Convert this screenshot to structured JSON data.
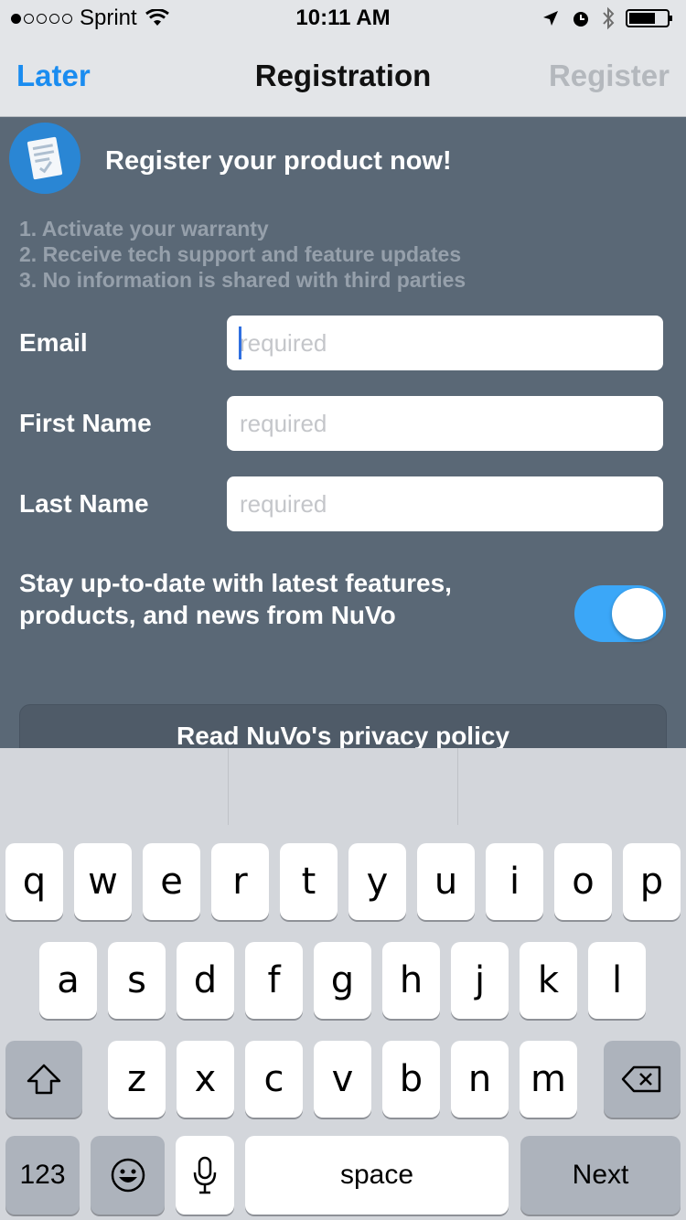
{
  "status_bar": {
    "carrier": "Sprint",
    "time": "10:11 AM"
  },
  "nav": {
    "left": "Later",
    "title": "Registration",
    "right": "Register"
  },
  "header": {
    "title": "Register your product now!"
  },
  "steps": [
    "1. Activate your warranty",
    "2. Receive tech support and feature updates",
    "3. No information is shared with third parties"
  ],
  "form": {
    "email": {
      "label": "Email",
      "placeholder": "required",
      "value": ""
    },
    "first_name": {
      "label": "First Name",
      "placeholder": "required",
      "value": ""
    },
    "last_name": {
      "label": "Last Name",
      "placeholder": "required",
      "value": ""
    }
  },
  "optin": {
    "label": "Stay up-to-date with latest features, products, and news from NuVo",
    "enabled": true
  },
  "policy": {
    "label": "Read NuVo's privacy policy"
  },
  "keyboard": {
    "row1": [
      "q",
      "w",
      "e",
      "r",
      "t",
      "y",
      "u",
      "i",
      "o",
      "p"
    ],
    "row2": [
      "a",
      "s",
      "d",
      "f",
      "g",
      "h",
      "j",
      "k",
      "l"
    ],
    "row3": [
      "z",
      "x",
      "c",
      "v",
      "b",
      "n",
      "m"
    ],
    "numbers": "123",
    "space": "space",
    "next": "Next"
  },
  "colors": {
    "accent": "#1a8cf0",
    "toggle_on": "#3ba7f8",
    "background": "#5a6876"
  }
}
